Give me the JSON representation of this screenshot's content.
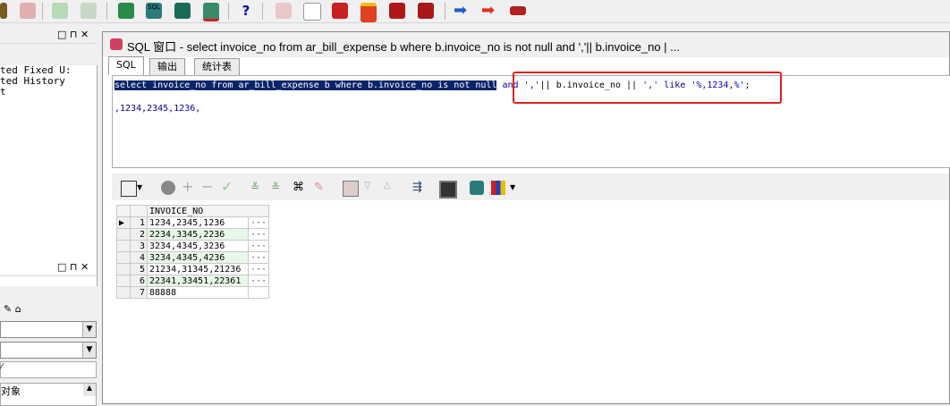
{
  "toolbar": {
    "icons": [
      "open-icon",
      "execute-icon",
      "import-icon",
      "export-icon",
      "commit-icon",
      "sql-icon",
      "run-icon",
      "connect-icon",
      "help-icon",
      "chart-icon",
      "eraser-icon",
      "book-icon",
      "pencil-icon",
      "tag-icon",
      "brush-icon",
      "forward-icon",
      "back-icon",
      "stop-icon"
    ],
    "sql_badge": "SQL",
    "help_glyph": "?"
  },
  "left_panel": {
    "controls": "□ ⊓ ✕",
    "list_items": [
      "ted Fixed U:",
      "ted History",
      "t"
    ],
    "lower_item": "对象",
    "lower_hint": "⁄"
  },
  "sql_window": {
    "title": "SQL 窗口 - select invoice_no from ar_bill_expense b where b.invoice_no is not null and ','|| b.invoice_no | ...",
    "tabs": [
      "SQL",
      "输出",
      "统计表"
    ],
    "sql_selected": "select invoice_no from ar_bill_expense  b where b.invoice_no is not null",
    "sql_and": "and",
    "sql_lit1": "','",
    "sql_op1": "||",
    "sql_col": "b.invoice_no",
    "sql_op2": "||",
    "sql_lit2": "','",
    "sql_like": "like",
    "sql_lit3": "'%,1234,%'",
    "sql_semicolon": ";",
    "output_line": ",1234,2345,1236,"
  },
  "grid": {
    "column": "INVOICE_NO",
    "rows": [
      {
        "num": "1",
        "value": "1234,2345,1236"
      },
      {
        "num": "2",
        "value": "2234,3345,2236"
      },
      {
        "num": "3",
        "value": "3234,4345,3236"
      },
      {
        "num": "4",
        "value": "3234,4345,4236"
      },
      {
        "num": "5",
        "value": "21234,31345,21236"
      },
      {
        "num": "6",
        "value": "22341,33451,22361"
      },
      {
        "num": "7",
        "value": "88888"
      }
    ],
    "ellipsis": "···"
  },
  "colors": {
    "selection": "#0a246a",
    "highlight_box": "#e02020",
    "keyword": "#0000a0"
  }
}
